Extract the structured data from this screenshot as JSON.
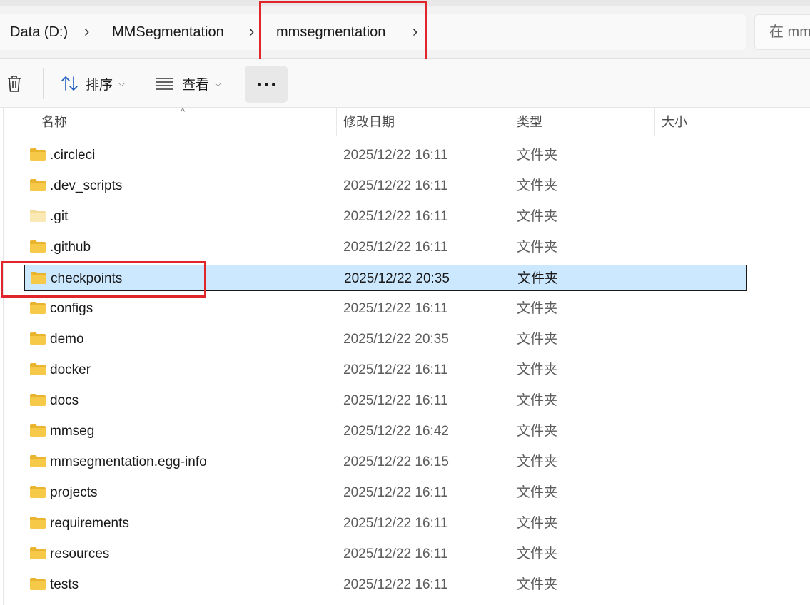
{
  "address": {
    "crumbs": [
      "Data (D:)",
      "MMSegmentation",
      "mmsegmentation"
    ],
    "search_placeholder": "在 mm"
  },
  "toolbar": {
    "sort_label": "排序",
    "view_label": "查看"
  },
  "columns": {
    "name": "名称",
    "modified": "修改日期",
    "type": "类型",
    "size": "大小"
  },
  "files": [
    {
      "name": ".circleci",
      "modified": "2025/12/22 16:11",
      "type": "文件夹"
    },
    {
      "name": ".dev_scripts",
      "modified": "2025/12/22 16:11",
      "type": "文件夹"
    },
    {
      "name": ".git",
      "modified": "2025/12/22 16:11",
      "type": "文件夹"
    },
    {
      "name": ".github",
      "modified": "2025/12/22 16:11",
      "type": "文件夹"
    },
    {
      "name": "checkpoints",
      "modified": "2025/12/22 20:35",
      "type": "文件夹"
    },
    {
      "name": "configs",
      "modified": "2025/12/22 16:11",
      "type": "文件夹"
    },
    {
      "name": "demo",
      "modified": "2025/12/22 20:35",
      "type": "文件夹"
    },
    {
      "name": "docker",
      "modified": "2025/12/22 16:11",
      "type": "文件夹"
    },
    {
      "name": "docs",
      "modified": "2025/12/22 16:11",
      "type": "文件夹"
    },
    {
      "name": "mmseg",
      "modified": "2025/12/22 16:42",
      "type": "文件夹"
    },
    {
      "name": "mmsegmentation.egg-info",
      "modified": "2025/12/22 16:15",
      "type": "文件夹"
    },
    {
      "name": "projects",
      "modified": "2025/12/22 16:11",
      "type": "文件夹"
    },
    {
      "name": "requirements",
      "modified": "2025/12/22 16:11",
      "type": "文件夹"
    },
    {
      "name": "resources",
      "modified": "2025/12/22 16:11",
      "type": "文件夹"
    },
    {
      "name": "tests",
      "modified": "2025/12/22 16:11",
      "type": "文件夹"
    }
  ],
  "selected_file": "checkpoints",
  "colors": {
    "selection": "#cce8ff",
    "highlight_box": "#e0252b",
    "folder": "#f7c948"
  }
}
